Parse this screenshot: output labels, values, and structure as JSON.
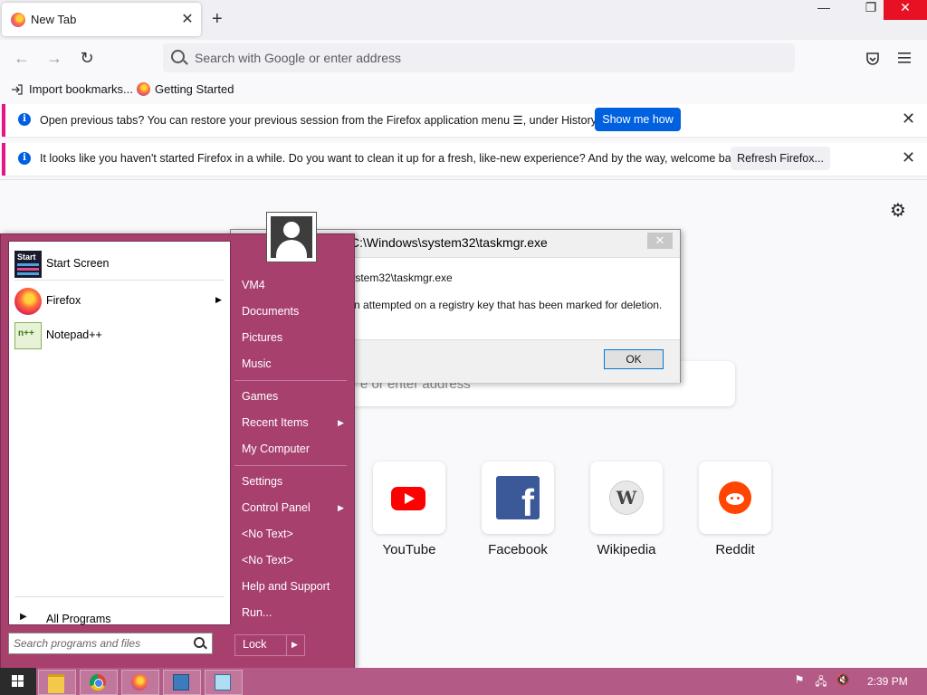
{
  "browser": {
    "tab_title": "New Tab",
    "tab_close": "✕",
    "new_tab": "+",
    "window_controls": {
      "minimize": "—",
      "restore": "❐",
      "close": "✕"
    },
    "nav": {
      "back": "←",
      "forward": "→",
      "reload": "↻"
    },
    "urlbar_placeholder": "Search with Google or enter address",
    "bookmarks": [
      {
        "label": "Import bookmarks...",
        "icon": "import-icon"
      },
      {
        "label": "Getting Started",
        "icon": "firefox-icon"
      }
    ],
    "notices": [
      {
        "text": "Open previous tabs? You can restore your previous session from the Firefox application menu ☰, under History.",
        "button": "Show me how"
      },
      {
        "text": "It looks like you haven't started Firefox in a while. Do you want to clean it up for a fresh, like-new experience? And by the way, welcome back!",
        "button": "Refresh Firefox..."
      }
    ],
    "newtab_search_placeholder": "e or enter address",
    "top_sites": [
      "YouTube",
      "Facebook",
      "Wikipedia",
      "Reddit"
    ]
  },
  "dialog": {
    "title": "C:\\Windows\\system32\\taskmgr.exe",
    "line1": "C:\\Windows\\system32\\taskmgr.exe",
    "line2": "Illegal operation attempted on a registry key that has been marked for deletion.",
    "ok": "OK",
    "close": "✕"
  },
  "start_menu": {
    "left_items": [
      {
        "label": "Start Screen",
        "icon": "start-screen-icon",
        "arrow": ""
      },
      {
        "label": "Firefox",
        "icon": "firefox-icon",
        "arrow": "▶"
      },
      {
        "label": "Notepad++",
        "icon": "notepadpp-icon",
        "arrow": ""
      }
    ],
    "all_programs": "All Programs",
    "search_placeholder": "Search programs and files",
    "right_items": [
      {
        "label": "VM4",
        "arrow": ""
      },
      {
        "label": "Documents",
        "arrow": ""
      },
      {
        "label": "Pictures",
        "arrow": ""
      },
      {
        "label": "Music",
        "arrow": ""
      },
      {
        "label": "Games",
        "arrow": ""
      },
      {
        "label": "Recent Items",
        "arrow": "▶"
      },
      {
        "label": "My Computer",
        "arrow": ""
      },
      {
        "label": "Settings",
        "arrow": ""
      },
      {
        "label": "Control Panel",
        "arrow": "▶"
      },
      {
        "label": "<No Text>",
        "arrow": ""
      },
      {
        "label": "<No Text>",
        "arrow": ""
      },
      {
        "label": "Help and Support",
        "arrow": ""
      },
      {
        "label": "Run...",
        "arrow": ""
      }
    ],
    "lock_label": "Lock",
    "lock_arrow": "▶"
  },
  "taskbar": {
    "items": [
      "file-explorer-icon",
      "chrome-icon",
      "firefox-icon",
      "task-manager-icon",
      "remote-desktop-icon"
    ],
    "clock": "2:39 PM",
    "tray": [
      "flag-icon",
      "network-icon",
      "volume-muted-icon"
    ]
  }
}
